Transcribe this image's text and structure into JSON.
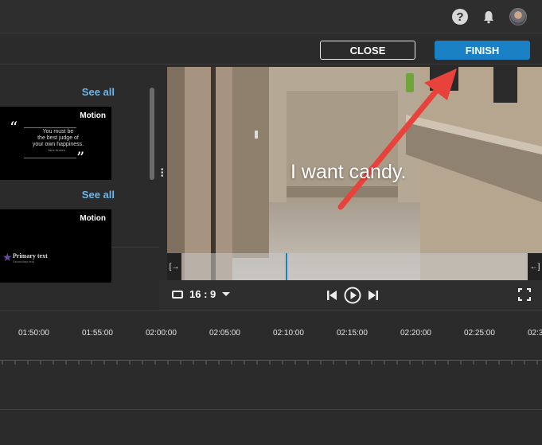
{
  "topbar": {
    "help_icon": "question-circle-icon",
    "bell_icon": "bell-icon",
    "avatar": "user-avatar"
  },
  "actions": {
    "close_label": "CLOSE",
    "finish_label": "FINISH"
  },
  "left_panel": {
    "sections": [
      {
        "see_all": "See all",
        "badge": "Motion",
        "quote_lines": [
          "You must be",
          "the best judge of",
          "your own happiness."
        ],
        "author": "Jane Austen"
      },
      {
        "see_all": "See all",
        "badge": "Motion",
        "primary": "Primary text",
        "secondary": "Secondary text"
      }
    ]
  },
  "video": {
    "caption": "I want candy.",
    "trim_start_icon": "trim-start-icon",
    "trim_end_icon": "trim-end-icon"
  },
  "controls": {
    "aspect_ratio": "16 : 9",
    "icons": [
      "aspect-ratio-icon",
      "skip-back-icon",
      "play-icon",
      "skip-forward-icon",
      "fullscreen-icon"
    ]
  },
  "timeline": {
    "ticks": [
      "01:50:00",
      "01:55:00",
      "02:00:00",
      "02:05:00",
      "02:10:00",
      "02:15:00",
      "02:20:00",
      "02:25:00",
      "02:3"
    ]
  },
  "colors": {
    "accent": "#1a80c6",
    "link": "#6cb6ea",
    "arrow": "#e8423c",
    "background": "#2b2b2b"
  }
}
